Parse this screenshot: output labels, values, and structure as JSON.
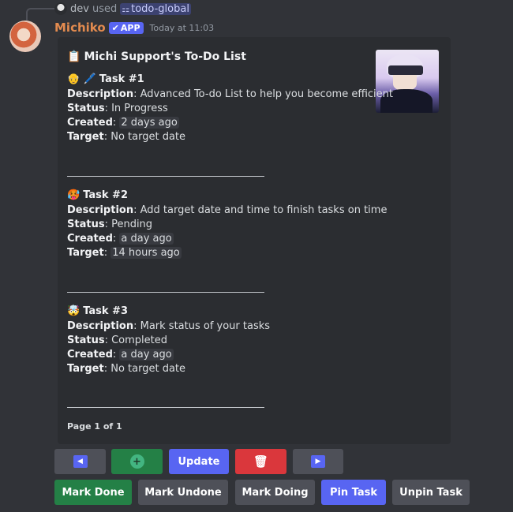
{
  "reference": {
    "user": "dev",
    "verb": "used",
    "command": "todo-global"
  },
  "message": {
    "author": "Michiko",
    "badge": "APP",
    "timestamp": "Today at 11:03"
  },
  "embed": {
    "title": "Michi Support's To-Do List",
    "title_icon": "📋",
    "tasks": [
      {
        "icons": "👴 🖊️",
        "title": "Task #1",
        "description_label": "Description",
        "description": "Advanced To-do List to help you become efficient",
        "status_label": "Status",
        "status": "In Progress",
        "created_label": "Created",
        "created": "2 days ago",
        "target_label": "Target",
        "target": "No target date"
      },
      {
        "icons": "🥵",
        "title": "Task #2",
        "description_label": "Description",
        "description": "Add target date and time to finish tasks on time",
        "status_label": "Status",
        "status": "Pending",
        "created_label": "Created",
        "created": "a day ago",
        "target_label": "Target",
        "target": "14 hours ago"
      },
      {
        "icons": "🤯",
        "title": "Task #3",
        "description_label": "Description",
        "description": "Mark status of your tasks",
        "status_label": "Status",
        "status": "Completed",
        "created_label": "Created",
        "created": "a day ago",
        "target_label": "Target",
        "target": "No target date"
      }
    ],
    "divider": "———————————————",
    "footer": "Page 1 of 1"
  },
  "buttons": {
    "row1": [
      {
        "name": "previous-page-button",
        "icon": "◀",
        "color": "#4e5058"
      },
      {
        "name": "add-task-button",
        "icon": "⊕",
        "color": "#248046"
      },
      {
        "name": "update-button",
        "label": "Update",
        "color": "#5865f2"
      },
      {
        "name": "delete-task-button",
        "icon": "🗑",
        "color": "#da373c"
      },
      {
        "name": "next-page-button",
        "icon": "▶",
        "color": "#4e5058"
      }
    ],
    "row2": [
      {
        "name": "mark-done-button",
        "label": "Mark Done",
        "color": "#248046"
      },
      {
        "name": "mark-undone-button",
        "label": "Mark Undone",
        "color": "#4e5058"
      },
      {
        "name": "mark-doing-button",
        "label": "Mark Doing",
        "color": "#4e5058"
      },
      {
        "name": "pin-task-button",
        "label": "Pin Task",
        "color": "#5865f2"
      },
      {
        "name": "unpin-task-button",
        "label": "Unpin Task",
        "color": "#4e5058"
      }
    ]
  }
}
